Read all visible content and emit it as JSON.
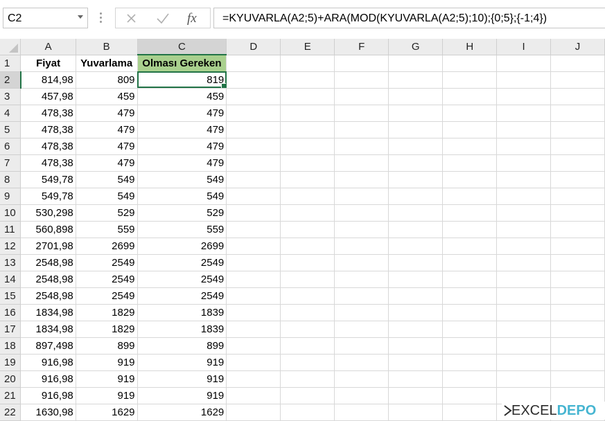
{
  "formula_bar": {
    "name_box": "C2",
    "formula": "=KYUVARLA(A2;5)+ARA(MOD(KYUVARLA(A2;5);10);{0;5};{-1;4})"
  },
  "columns": [
    "A",
    "B",
    "C",
    "D",
    "E",
    "F",
    "G",
    "H",
    "I",
    "J"
  ],
  "header_row": {
    "row": "1",
    "a": "Fiyat",
    "b": "Yuvarlama",
    "c": "Olması Gereken"
  },
  "rows": [
    {
      "row": "2",
      "a": "814,98",
      "b": "809",
      "c": "819"
    },
    {
      "row": "3",
      "a": "457,98",
      "b": "459",
      "c": "459"
    },
    {
      "row": "4",
      "a": "478,38",
      "b": "479",
      "c": "479"
    },
    {
      "row": "5",
      "a": "478,38",
      "b": "479",
      "c": "479"
    },
    {
      "row": "6",
      "a": "478,38",
      "b": "479",
      "c": "479"
    },
    {
      "row": "7",
      "a": "478,38",
      "b": "479",
      "c": "479"
    },
    {
      "row": "8",
      "a": "549,78",
      "b": "549",
      "c": "549"
    },
    {
      "row": "9",
      "a": "549,78",
      "b": "549",
      "c": "549"
    },
    {
      "row": "10",
      "a": "530,298",
      "b": "529",
      "c": "529"
    },
    {
      "row": "11",
      "a": "560,898",
      "b": "559",
      "c": "559"
    },
    {
      "row": "12",
      "a": "2701,98",
      "b": "2699",
      "c": "2699"
    },
    {
      "row": "13",
      "a": "2548,98",
      "b": "2549",
      "c": "2549"
    },
    {
      "row": "14",
      "a": "2548,98",
      "b": "2549",
      "c": "2549"
    },
    {
      "row": "15",
      "a": "2548,98",
      "b": "2549",
      "c": "2549"
    },
    {
      "row": "16",
      "a": "1834,98",
      "b": "1829",
      "c": "1839"
    },
    {
      "row": "17",
      "a": "1834,98",
      "b": "1829",
      "c": "1839"
    },
    {
      "row": "18",
      "a": "897,498",
      "b": "899",
      "c": "899"
    },
    {
      "row": "19",
      "a": "916,98",
      "b": "919",
      "c": "919"
    },
    {
      "row": "20",
      "a": "916,98",
      "b": "919",
      "c": "919"
    },
    {
      "row": "21",
      "a": "916,98",
      "b": "919",
      "c": "919"
    },
    {
      "row": "22",
      "a": "1630,98",
      "b": "1629",
      "c": "1629"
    }
  ],
  "selected_cell": "C2",
  "colors": {
    "accent": "#217346",
    "header_fill": "#a9d08e"
  },
  "watermark": {
    "text_a": "EXCEL",
    "text_b": "DEPO"
  },
  "icons": {
    "cancel": "close-icon",
    "enter": "check-icon",
    "function": "fx-icon",
    "name_box_dropdown": "chevron-down-icon",
    "select_all": "select-all-triangle"
  }
}
